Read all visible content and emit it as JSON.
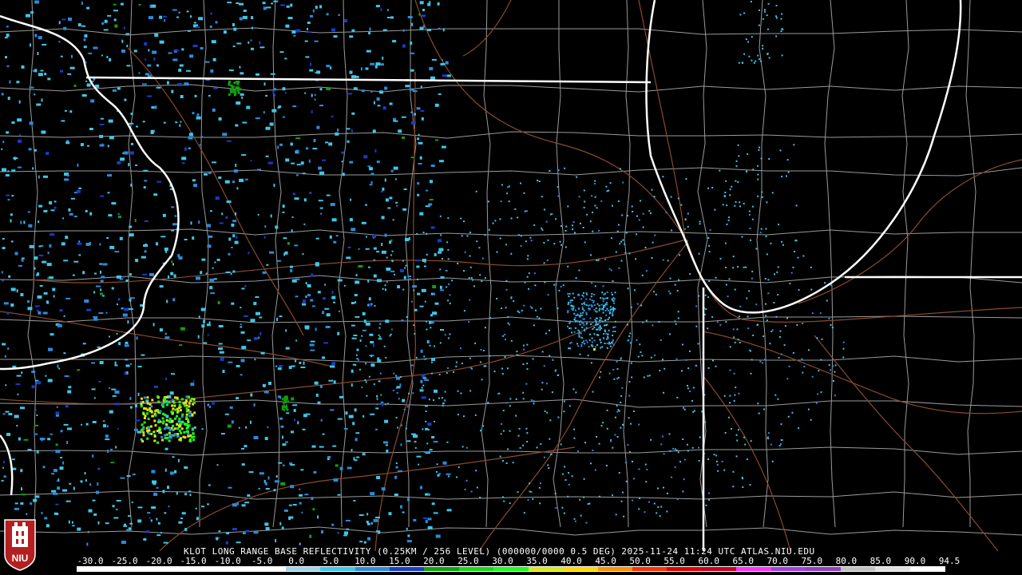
{
  "header": {
    "title": "KLOT LONG RANGE BASE REFLECTIVITY (0.25KM / 256 LEVEL) (000000/0000 0.5 DEG) 2025-11-24 11:24 UTC  ATLAS.NIU.EDU"
  },
  "logo": {
    "text": "NIU"
  },
  "scale": {
    "labels": [
      "-30.0",
      "-25.0",
      "-20.0",
      "-15.0",
      "-10.0",
      "-5.0",
      "0.0",
      "5.0",
      "10.0",
      "15.0",
      "20.0",
      "25.0",
      "30.0",
      "35.0",
      "40.0",
      "45.0",
      "50.0",
      "55.0",
      "60.0",
      "65.0",
      "70.0",
      "75.0",
      "80.0",
      "85.0",
      "90.0",
      "94.5"
    ],
    "colors": [
      "#ffffff",
      "#ffffff",
      "#ffffff",
      "#ffffff",
      "#ffffff",
      "#ffffff",
      "#9cd6e6",
      "#3fc6e8",
      "#2a8cdc",
      "#1a3cc8",
      "#10a010",
      "#14d814",
      "#18ff18",
      "#d8e818",
      "#ffd800",
      "#ff9000",
      "#ff3000",
      "#e00000",
      "#c80020",
      "#ff30ff",
      "#a040e0",
      "#9040c0",
      "#c0c0c0",
      "#e0e0e0",
      "#ffffff"
    ]
  },
  "map": {
    "state_boundary_color": "#ffffff",
    "county_line_color": "#9a9a9a",
    "road_color": "#8b4a2b",
    "echo_colors": [
      "#3fc6e8",
      "#2a8cdc",
      "#1a3cc8",
      "#10a010",
      "#18ff18",
      "#d8e818",
      "#ffd800"
    ]
  }
}
